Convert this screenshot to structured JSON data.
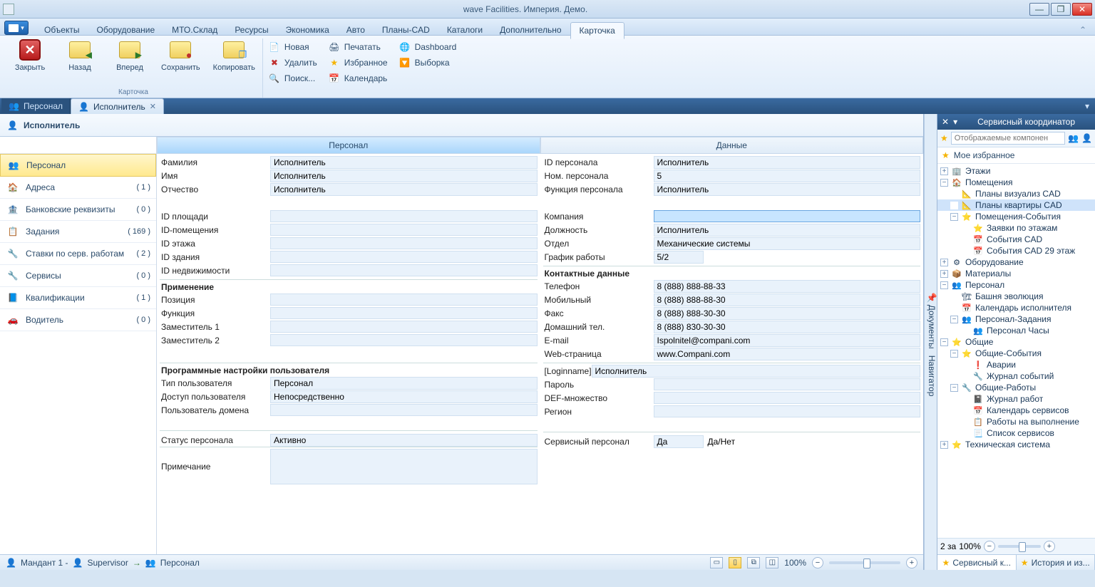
{
  "title": "wave Facilities. Империя. Демо.",
  "menu": {
    "tabs": [
      "Объекты",
      "Оборудование",
      "МТО.Склад",
      "Ресурсы",
      "Экономика",
      "Авто",
      "Планы-CAD",
      "Каталоги",
      "Дополнительно",
      "Карточка"
    ],
    "active": 9
  },
  "ribbon": {
    "close": "Закрыть",
    "back": "Назад",
    "forward": "Вперед",
    "save": "Сохранить",
    "copy": "Копировать",
    "group_caption": "Карточка",
    "small": {
      "new": "Новая",
      "delete": "Удалить",
      "search": "Поиск...",
      "print": "Печатать",
      "favorite": "Избранное",
      "calendar": "Календарь",
      "dashboard": "Dashboard",
      "selection": "Выборка"
    }
  },
  "doctabs": {
    "t0": "Персонал",
    "t1": "Исполнитель"
  },
  "card_title": "Исполнитель",
  "leftnav": [
    {
      "label": "Персонал",
      "count": "",
      "active": true
    },
    {
      "label": "Адреса",
      "count": "( 1 )"
    },
    {
      "label": "Банковские реквизиты",
      "count": "( 0 )"
    },
    {
      "label": "Задания",
      "count": "( 169 )"
    },
    {
      "label": "Ставки по серв. работам",
      "count": "( 2 )"
    },
    {
      "label": "Сервисы",
      "count": "( 0 )"
    },
    {
      "label": "Квалификации",
      "count": "( 1 )"
    },
    {
      "label": "Водитель",
      "count": "( 0 )"
    }
  ],
  "col_left_title": "Персонал",
  "col_right_title": "Данные",
  "left": {
    "familiya_l": "Фамилия",
    "familiya_v": "Исполнитель",
    "imya_l": "Имя",
    "imya_v": "Исполнитель",
    "otch_l": "Отчество",
    "otch_v": "Исполнитель",
    "id_area_l": "ID площади",
    "id_area_v": "",
    "id_room_l": "ID-помещения",
    "id_room_v": "",
    "id_floor_l": "ID этажа",
    "id_floor_v": "",
    "id_bld_l": "ID здания",
    "id_bld_v": "",
    "id_prop_l": "ID недвижимости",
    "id_prop_v": "",
    "sec_app": "Применение",
    "pos_l": "Позиция",
    "pos_v": "",
    "func_l": "Функция",
    "func_v": "",
    "dep1_l": "Заместитель 1",
    "dep1_v": "",
    "dep2_l": "Заместитель 2",
    "dep2_v": "",
    "sec_prog": "Программные настройки пользователя",
    "utype_l": "Тип пользователя",
    "utype_v": "Персонал",
    "uacc_l": "Доступ пользователя",
    "uacc_v": "Непосредственно",
    "udom_l": "Пользователь домена",
    "udom_v": "",
    "status_l": "Статус персонала",
    "status_v": "Активно",
    "note_l": "Примечание",
    "note_v": ""
  },
  "right": {
    "pid_l": "ID персонала",
    "pid_v": "Исполнитель",
    "pnum_l": "Ном. персонала",
    "pnum_v": "5",
    "pfunc_l": "Функция персонала",
    "pfunc_v": "Исполнитель",
    "comp_l": "Компания",
    "comp_v": "",
    "job_l": "Должность",
    "job_v": "Исполнитель",
    "dept_l": "Отдел",
    "dept_v": "Механические системы",
    "sched_l": "График работы",
    "sched_v": "5/2",
    "sec_contact": "Контактные данные",
    "tel_l": "Телефон",
    "tel_v": "8 (888) 888-88-33",
    "mob_l": "Мобильный",
    "mob_v": "8 (888) 888-88-30",
    "fax_l": "Факс",
    "fax_v": "8 (888) 888-30-30",
    "home_l": "Домашний тел.",
    "home_v": "8 (888) 830-30-30",
    "email_l": "E-mail",
    "email_v": "Ispolnitel@compani.com",
    "web_l": "Web-страница",
    "web_v": "www.Compani.com",
    "login_l": "[Loginname]",
    "login_v": "Исполнитель",
    "pass_l": "Пароль",
    "pass_v": "",
    "def_l": "DEF-множество",
    "def_v": "",
    "region_l": "Регион",
    "region_v": "",
    "srv_l": "Сервисный персонал",
    "srv_v": "Да",
    "srv_hint": "Да/Нет"
  },
  "cardfoot": {
    "mandant": "Мандант 1 -",
    "supervisor": "Supervisor",
    "crumb": "Персонал",
    "zoom": "100%"
  },
  "sidepanel": {
    "title": "Сервисный координатор",
    "search_placeholder": "Отображаемые компонен",
    "favorites": "Мое избранное",
    "tree": [
      {
        "tw": "+",
        "ind": 0,
        "ico": "🏢",
        "label": "Этажи"
      },
      {
        "tw": "−",
        "ind": 0,
        "ico": "🏠",
        "label": "Помещения"
      },
      {
        "tw": "",
        "ind": 1,
        "ico": "📐",
        "label": "Планы визуализ CAD"
      },
      {
        "tw": "",
        "ind": 1,
        "ico": "📐",
        "label": "Планы квартиры CAD",
        "sel": true
      },
      {
        "tw": "−",
        "ind": 1,
        "ico": "⭐",
        "label": "Помещения-События"
      },
      {
        "tw": "",
        "ind": 2,
        "ico": "⭐",
        "label": "Заявки по этажам"
      },
      {
        "tw": "",
        "ind": 2,
        "ico": "📅",
        "label": "События CAD"
      },
      {
        "tw": "",
        "ind": 2,
        "ico": "📅",
        "label": "События CAD 29 этаж"
      },
      {
        "tw": "+",
        "ind": 0,
        "ico": "⚙",
        "label": "Оборудование"
      },
      {
        "tw": "+",
        "ind": 0,
        "ico": "📦",
        "label": "Материалы"
      },
      {
        "tw": "−",
        "ind": 0,
        "ico": "👥",
        "label": "Персонал"
      },
      {
        "tw": "",
        "ind": 1,
        "ico": "🏗",
        "label": "Башня эволюция"
      },
      {
        "tw": "",
        "ind": 1,
        "ico": "📅",
        "label": "Календарь исполнителя"
      },
      {
        "tw": "−",
        "ind": 1,
        "ico": "👥",
        "label": "Персонал-Задания"
      },
      {
        "tw": "",
        "ind": 2,
        "ico": "👥",
        "label": "Персонал Часы"
      },
      {
        "tw": "−",
        "ind": 0,
        "ico": "⭐",
        "label": "Общие"
      },
      {
        "tw": "−",
        "ind": 1,
        "ico": "⭐",
        "label": "Общие-События"
      },
      {
        "tw": "",
        "ind": 2,
        "ico": "❗",
        "label": "Аварии"
      },
      {
        "tw": "",
        "ind": 2,
        "ico": "🔧",
        "label": "Журнал событий"
      },
      {
        "tw": "−",
        "ind": 1,
        "ico": "🔧",
        "label": "Общие-Работы"
      },
      {
        "tw": "",
        "ind": 2,
        "ico": "📓",
        "label": "Журнал работ"
      },
      {
        "tw": "",
        "ind": 2,
        "ico": "📅",
        "label": "Календарь сервисов"
      },
      {
        "tw": "",
        "ind": 2,
        "ico": "📋",
        "label": "Работы на выполнение"
      },
      {
        "tw": "",
        "ind": 2,
        "ico": "📃",
        "label": "Список сервисов"
      },
      {
        "tw": "+",
        "ind": 0,
        "ico": "⭐",
        "label": "Техническая система"
      }
    ],
    "bottom_label": "2 за",
    "bottom_zoom": "100%",
    "tab0": "Сервисный к...",
    "tab1": "История и из..."
  },
  "rightstrip": {
    "a": "Документы",
    "b": "Навигатор"
  }
}
